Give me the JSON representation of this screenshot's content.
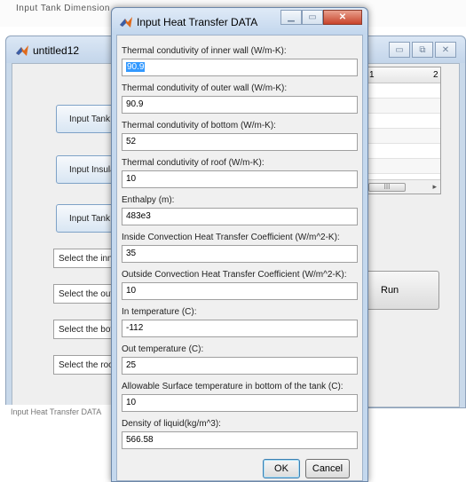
{
  "background": {
    "top_fragment": "Input Tank Dimension",
    "bottom_fragment": "Input Heat Transfer DATA"
  },
  "main_window": {
    "title": "untitled12",
    "buttons": [
      "Input Tank Dimension",
      "Input Insulation",
      "Input Tank Heat Transfer"
    ],
    "selects": [
      "Select the inner wall",
      "Select the outer wall",
      "Select the bottom",
      "Select the roof"
    ],
    "table": {
      "columns": [
        "1",
        "2"
      ],
      "scroll_thumb": "III",
      "scroll_arrow": "▸"
    },
    "run_label": "Run",
    "controls": {
      "minimize": "▭",
      "maximize": "⧉",
      "close": "✕"
    }
  },
  "dialog": {
    "title": "Input Heat Transfer DATA",
    "controls": {
      "minimize": "▁",
      "maximize": "▭",
      "close": "✕"
    },
    "fields": [
      {
        "label": "Thermal condutivity of inner wall (W/m-K):",
        "value": "90.9"
      },
      {
        "label": "Thermal condutivity of outer wall (W/m-K):",
        "value": "90.9"
      },
      {
        "label": "Thermal condutivity of bottom (W/m-K):",
        "value": "52"
      },
      {
        "label": "Thermal condutivity of roof (W/m-K):",
        "value": "10"
      },
      {
        "label": "Enthalpy (m):",
        "value": "483e3"
      },
      {
        "label": "Inside Convection Heat Transfer Coefficient (W/m^2-K):",
        "value": "35"
      },
      {
        "label": "Outside Convection Heat Transfer Coefficient (W/m^2-K):",
        "value": "10"
      },
      {
        "label": "In temperature (C):",
        "value": "-112"
      },
      {
        "label": "Out temperature (C):",
        "value": "25"
      },
      {
        "label": "Allowable Surface temperature in bottom of the tank (C):",
        "value": "10"
      },
      {
        "label": "Density of liquid(kg/m^3):",
        "value": "566.58"
      }
    ],
    "ok_label": "OK",
    "cancel_label": "Cancel"
  },
  "colors": {
    "title_bar": "#c4d8ee",
    "selection": "#3399ff",
    "close_button": "#c8432a"
  }
}
